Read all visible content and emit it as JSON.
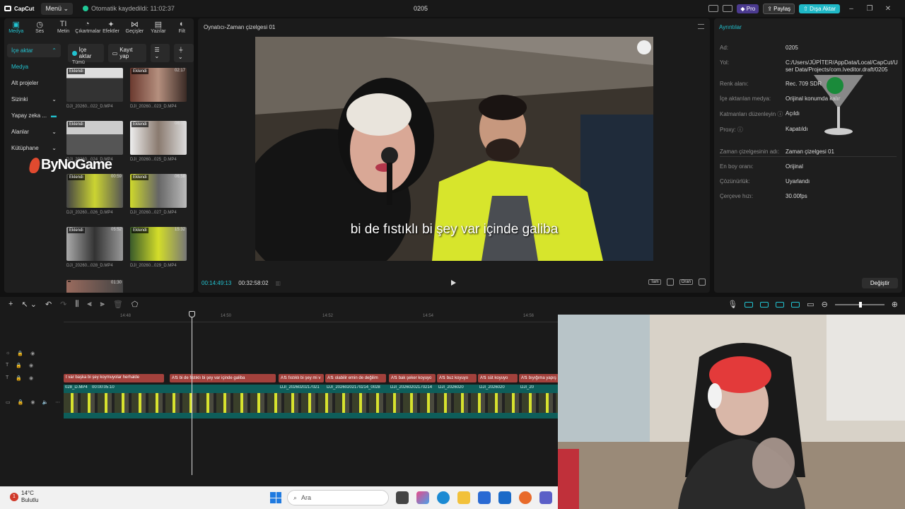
{
  "titlebar": {
    "app_name": "CapCut",
    "menu_label": "Menü",
    "autosave_text": "Otomatik kaydedildi: 11:02:37",
    "project_title": "0205",
    "pro_label": "Pro",
    "share_label": "Paylaş",
    "export_label": "Dışa Aktar"
  },
  "toolbar": {
    "tabs": [
      {
        "label": "Medya",
        "icon": "media-icon"
      },
      {
        "label": "Ses",
        "icon": "audio-icon"
      },
      {
        "label": "Metin",
        "icon": "text-icon"
      },
      {
        "label": "Çıkartmalar",
        "icon": "sticker-icon"
      },
      {
        "label": "Efektler",
        "icon": "effects-icon"
      },
      {
        "label": "Geçişler",
        "icon": "transitions-icon"
      },
      {
        "label": "Yazılar",
        "icon": "captions-icon"
      },
      {
        "label": "Filt",
        "icon": "filters-icon"
      }
    ]
  },
  "sidenav": {
    "items": [
      {
        "label": "İçe aktar",
        "caret": "⌃"
      },
      {
        "label": "Medya"
      },
      {
        "label": "Alt projeler"
      },
      {
        "label": "Sizinki",
        "caret": "⌄"
      },
      {
        "label": "Yapay zeka ..."
      },
      {
        "label": "Alanlar",
        "caret": "⌄"
      },
      {
        "label": "Kütüphane",
        "caret": "⌄"
      }
    ]
  },
  "brand": {
    "text": "ByNoGame"
  },
  "media": {
    "import_label": "İçe aktar",
    "record_label": "Kayıt yap",
    "all_label": "Tümü",
    "clips": [
      {
        "badge": "Eklendi",
        "duration": "01:24",
        "name": "DJI_20260...022_D.MP4"
      },
      {
        "badge": "Eklendi",
        "duration": "02:17",
        "name": "DJI_20260...023_D.MP4"
      },
      {
        "badge": "Eklendi",
        "duration": "",
        "name": "DJI_20260...024_D.MP4"
      },
      {
        "badge": "Eklendi",
        "duration": "06:00",
        "name": "DJI_20260...025_D.MP4"
      },
      {
        "badge": "Eklendi",
        "duration": "00:59",
        "name": "DJI_20260...026_D.MP4"
      },
      {
        "badge": "Eklendi",
        "duration": "06:58",
        "name": "DJI_20260...027_D.MP4"
      },
      {
        "badge": "Eklendi",
        "duration": "05:52",
        "name": "DJI_20260...028_D.MP4"
      },
      {
        "badge": "Eklendi",
        "duration": "15:32",
        "name": "DJI_20260...029_D.MP4"
      },
      {
        "badge": "",
        "duration": "01:30",
        "name": ""
      }
    ]
  },
  "player": {
    "title": "Oynatıcı-Zaman çizelgesi 01",
    "subtitle": "bi de fıstıklı bi şey var içinde galiba",
    "current_time": "00:14:49:13",
    "total_time": "00:32:58:02",
    "full_label": "Tam",
    "ratio_label": "Oran"
  },
  "details": {
    "title": "Ayrıntılar",
    "rows": [
      {
        "label": "Ad:",
        "value": "0205"
      },
      {
        "label": "Yol:",
        "value": "C:/Users/JÜPİTER/AppData/Local/CapCut/User Data/Projects/com.lveditor.draft/0205"
      },
      {
        "label": "Renk alanı:",
        "value": "Rec. 709 SDR"
      },
      {
        "label": "İçe aktarılan medya:",
        "value": "Orijinal konumda kalır"
      },
      {
        "label": "Katmanları düzenleyin ⓘ",
        "value": "Açıldı"
      },
      {
        "label": "Proxy: ⓘ",
        "value": "Kapatıldı"
      }
    ],
    "rows2": [
      {
        "label": "Zaman çizelgesinin adı:",
        "value": "Zaman çizelgesi 01"
      },
      {
        "label": "En boy oranı:",
        "value": "Orijinal"
      },
      {
        "label": "Çözünürlük:",
        "value": "Uyarlandı"
      },
      {
        "label": "Çerçeve hızı:",
        "value": "30.00fps"
      }
    ],
    "change_label": "Değiştir"
  },
  "timeline": {
    "ticks": [
      "14:48",
      "14:50",
      "14:52",
      "14:54",
      "14:56"
    ],
    "text_clips": [
      "t var başka bi şey koymuyolar herhalde",
      "bi de fıstıklı bi şey var içinde galiba",
      "fıstıklı bi şey mi v",
      "olabilir emin de değilim",
      "bak şeker koyuyo",
      "buz koyuyo",
      "süt koyuyo",
      "bıyığıma yapış"
    ],
    "video_labels": [
      "028_D.MP4",
      "00:00:05:10",
      "DJI_2026020217021",
      "DJI_20260202170214_0028",
      "DJI_20260202170214",
      "DJI_2026020",
      "DJI_2026020",
      "DJI_20"
    ]
  },
  "taskbar": {
    "temp": "14°C",
    "weather": "Bulutlu",
    "notification_count": "1",
    "search_placeholder": "Ara"
  }
}
